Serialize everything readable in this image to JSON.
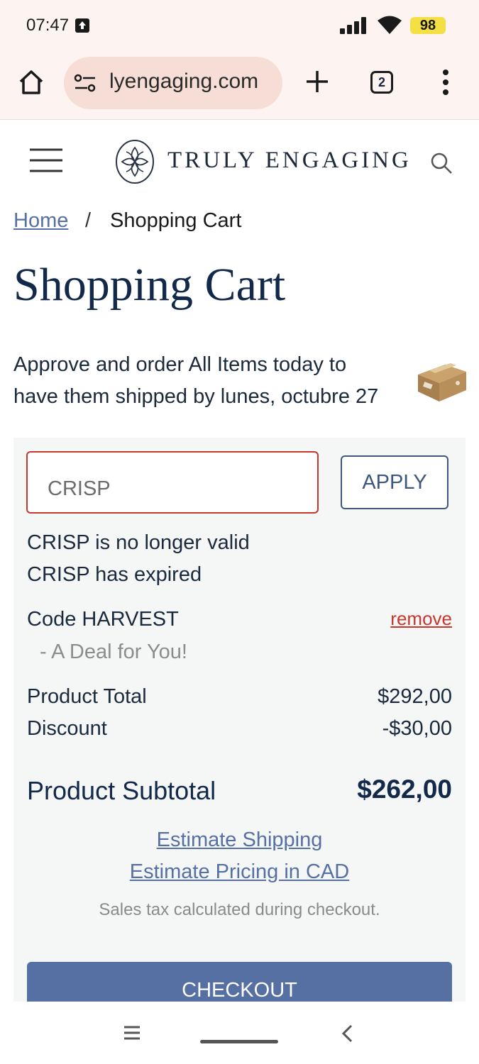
{
  "status_bar": {
    "time": "07:47",
    "battery": "98"
  },
  "browser": {
    "url": "lyengaging.com",
    "tab_count": "2"
  },
  "site": {
    "brand": "TRULY ENGAGING"
  },
  "breadcrumb": {
    "home": "Home",
    "separator": "/",
    "current": "Shopping Cart"
  },
  "page": {
    "title": "Shopping Cart",
    "shipping_notice": "Approve and order All Items today to have them shipped by lunes, octubre 27"
  },
  "cart": {
    "coupon_value": "CRISP",
    "apply_label": "APPLY",
    "errors": [
      "CRISP is no longer valid",
      "CRISP has expired"
    ],
    "applied_code_label": "Code HARVEST",
    "remove_label": "remove",
    "deal_name": "- A Deal for You!",
    "product_total_label": "Product Total",
    "product_total_value": "$292,00",
    "discount_label": "Discount",
    "discount_value": "-$30,00",
    "subtotal_label": "Product Subtotal",
    "subtotal_value": "$262,00",
    "estimate_shipping": "Estimate Shipping",
    "estimate_pricing": "Estimate Pricing in CAD",
    "tax_note": "Sales tax calculated during checkout.",
    "checkout_label": "CHECKOUT"
  },
  "colors": {
    "accent": "#5770a4",
    "error": "#c8372d",
    "title": "#13294a",
    "panel_bg": "#f5f7f7"
  }
}
